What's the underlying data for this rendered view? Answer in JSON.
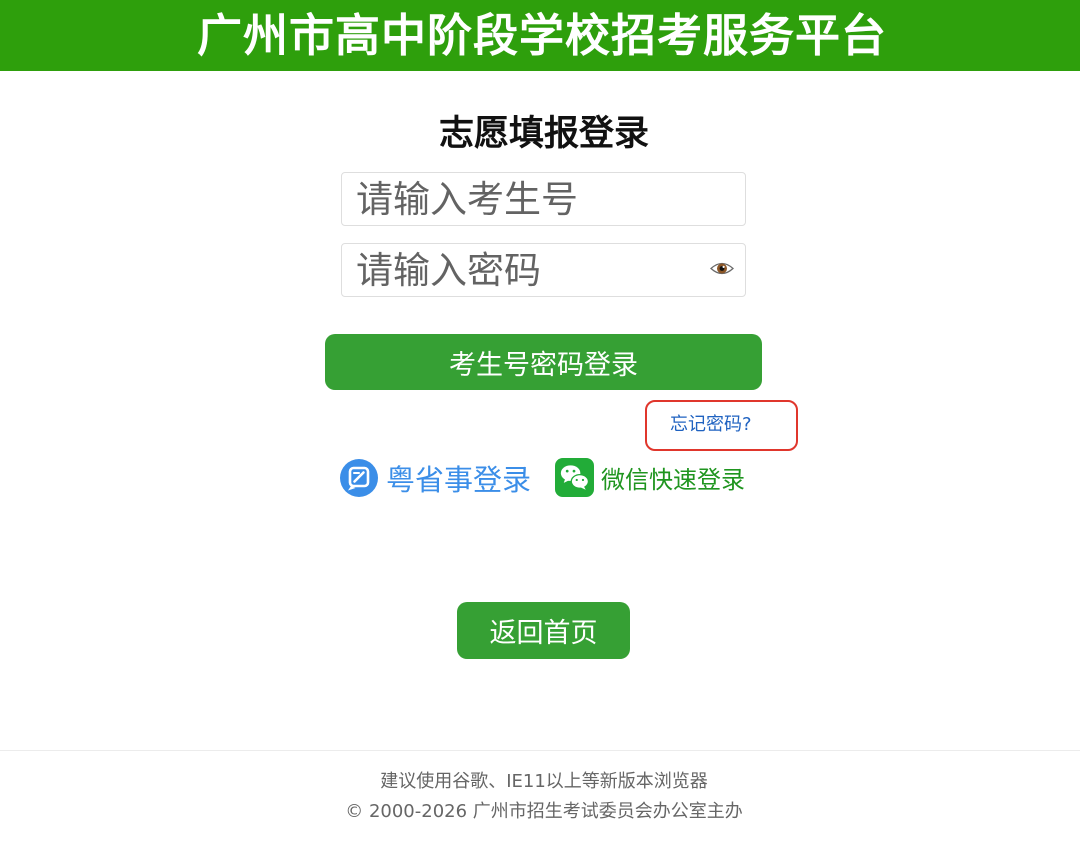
{
  "header": {
    "title": "广州市高中阶段学校招考服务平台"
  },
  "login": {
    "title": "志愿填报登录",
    "exam_id": {
      "placeholder": "请输入考生号",
      "value": ""
    },
    "password": {
      "placeholder": "请输入密码",
      "value": "",
      "toggle_icon": "eye-icon"
    },
    "submit_label": "考生号密码登录",
    "forgot_password_label": "忘记密码?"
  },
  "alt_login": {
    "yueshengshi": {
      "label": "粤省事登录",
      "icon": "yueshengshi-icon"
    },
    "wechat": {
      "label": "微信快速登录",
      "icon": "wechat-icon"
    }
  },
  "back_home_label": "返回首页",
  "footer": {
    "browser_tip": "建议使用谷歌、IE11以上等新版本浏览器",
    "copyright": "© 2000-2026 广州市招生考试委员会办公室主办"
  },
  "colors": {
    "brand_green": "#2e9f0c",
    "button_green": "#36a034",
    "link_blue": "#1f62c0",
    "yueshengshi_blue": "#3b8ee8",
    "wechat_green": "#1f951f",
    "highlight_red": "#e0362c"
  }
}
